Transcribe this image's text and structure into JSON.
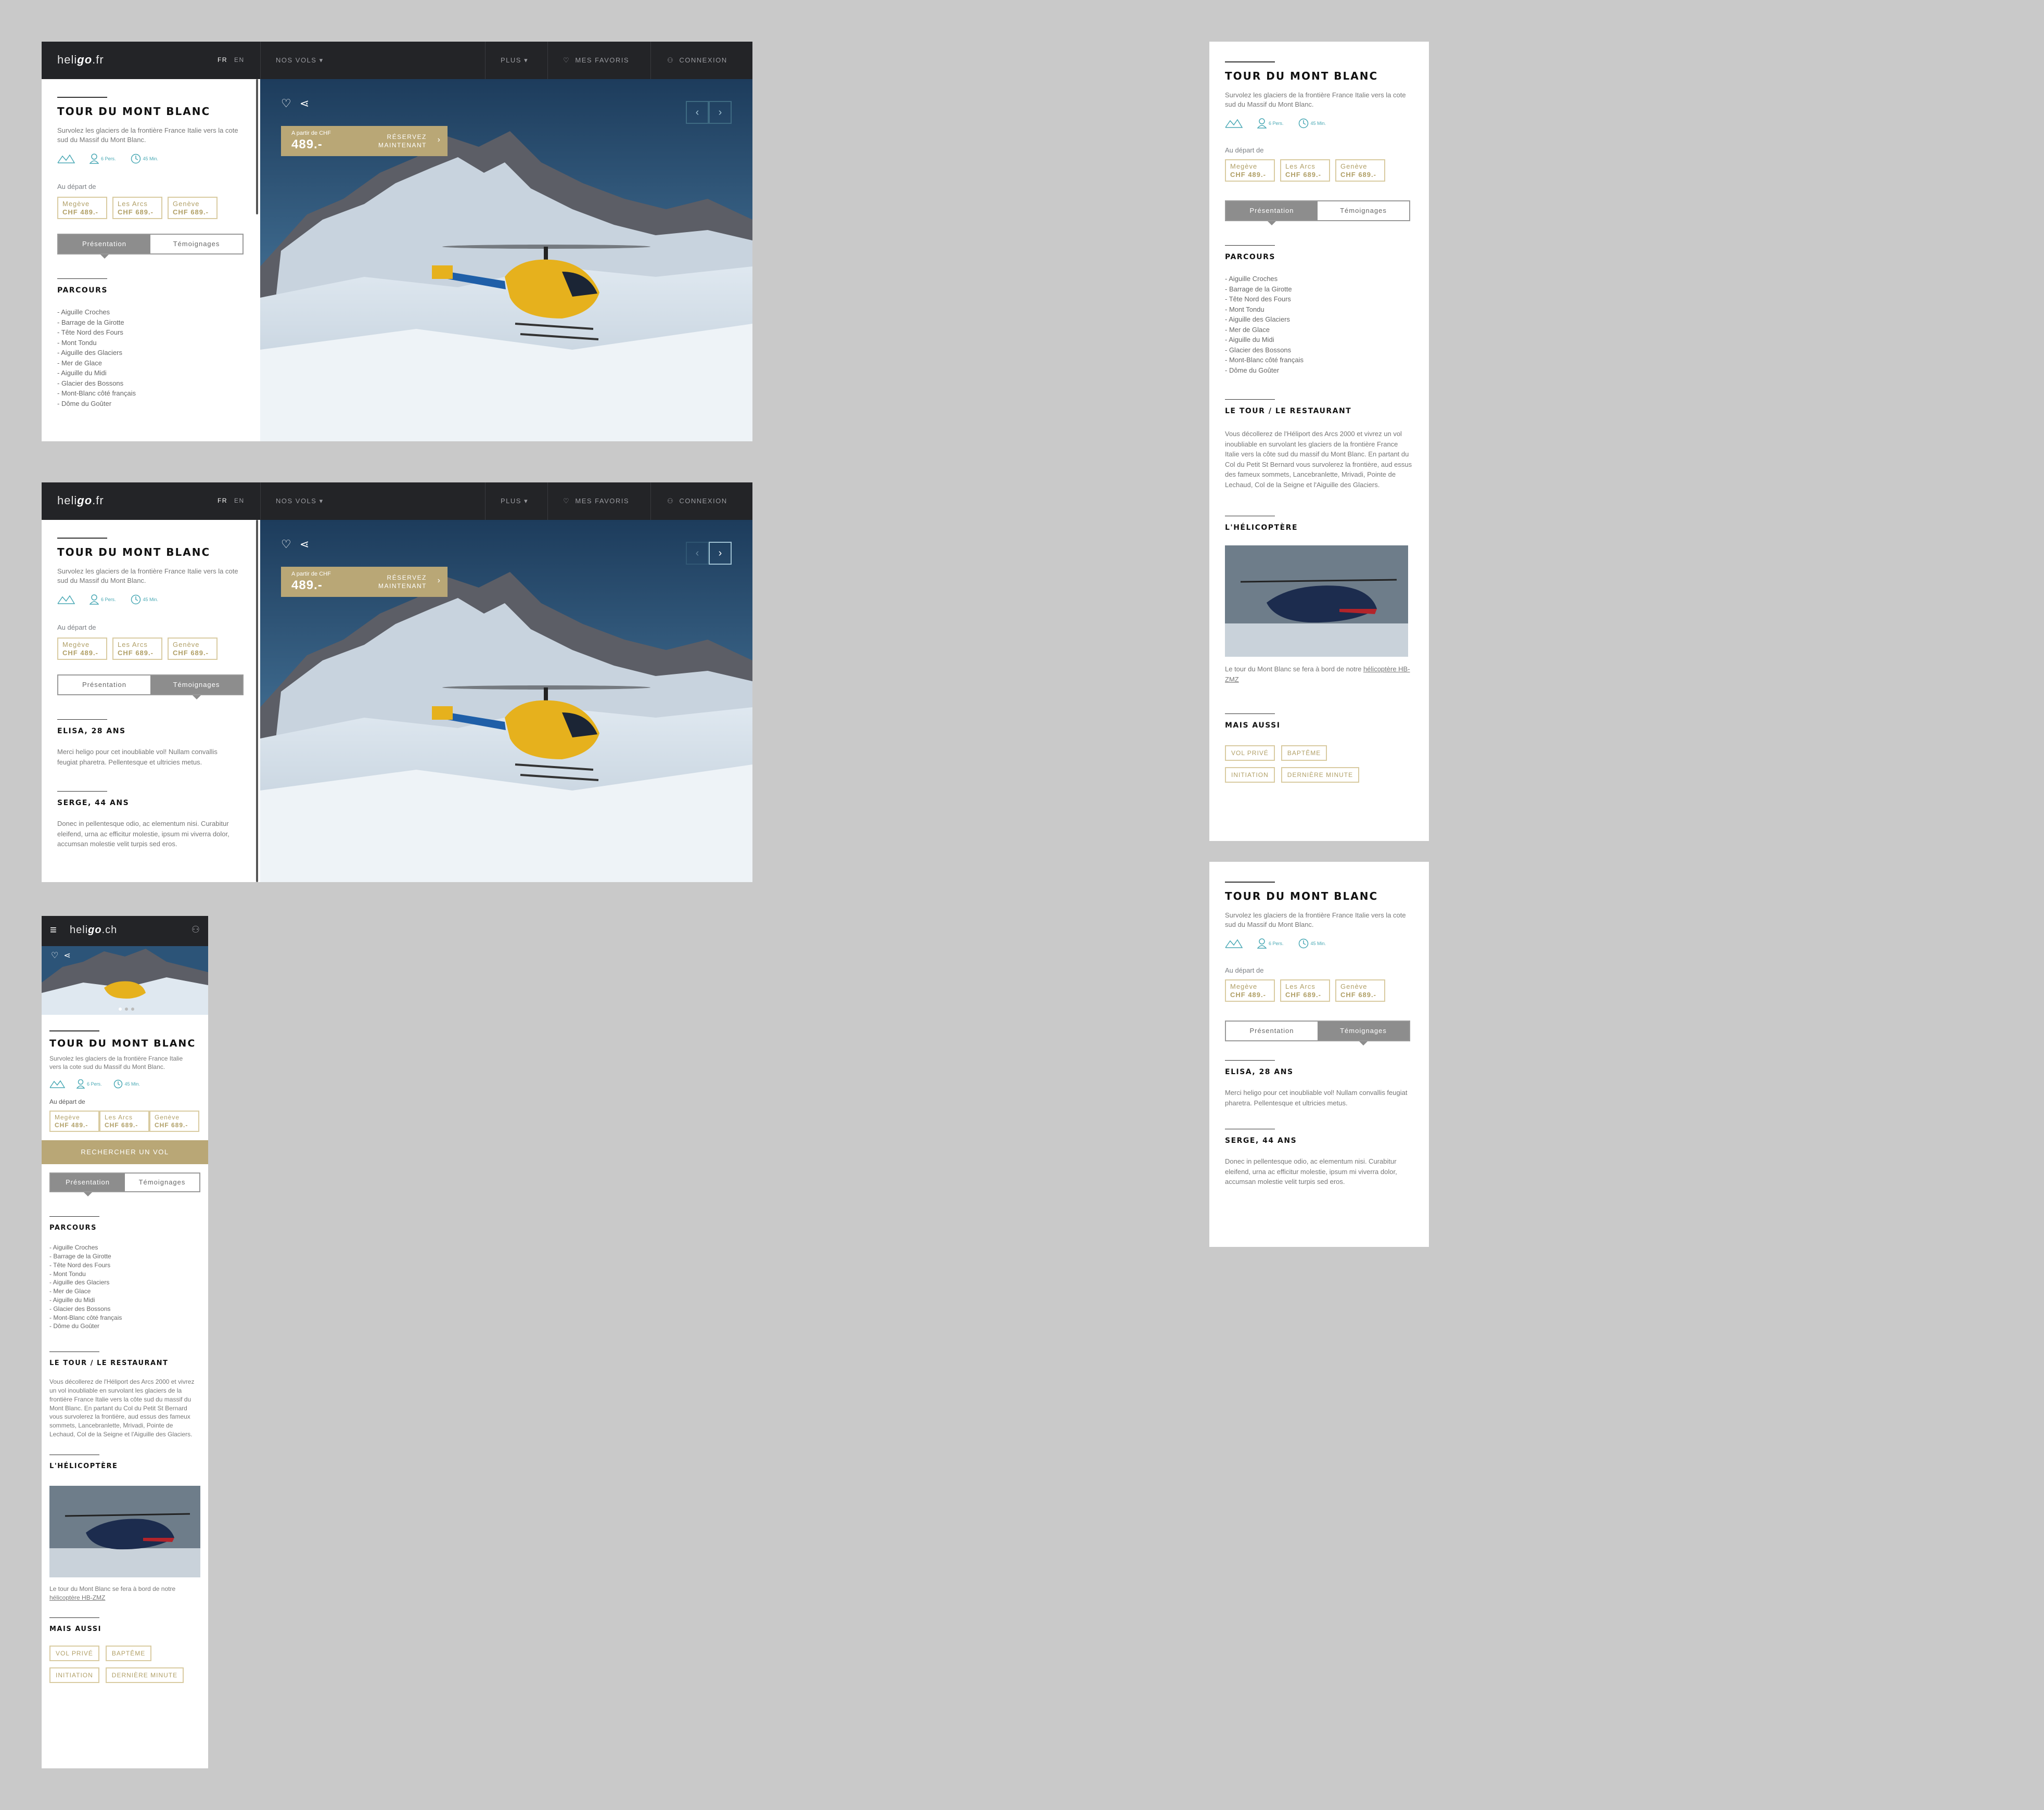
{
  "nav": {
    "logo_pre": "heli",
    "logo_go": "go",
    "logo_fr": ".fr",
    "logo_ch": ".ch",
    "lang_fr": "FR",
    "lang_en": "EN",
    "nos_vols": "NOS VOLS",
    "plus": "PLUS",
    "favoris": "MES FAVORIS",
    "connexion": "CONNEXION"
  },
  "tour": {
    "title": "TOUR DU MONT BLANC",
    "lead": "Survolez les glaciers de la frontière France Italie vers la cote sud du Massif du Mont Blanc.",
    "persons": "6 Pers.",
    "minutes": "45 Min.",
    "depart_label": "Au départ de",
    "departures": [
      {
        "city": "Megève",
        "price": "CHF 489.-"
      },
      {
        "city": "Les Arcs",
        "price": "CHF 689.-"
      },
      {
        "city": "Genève",
        "price": "CHF 689.-"
      }
    ],
    "tab_presentation": "Présentation",
    "tab_temoignages": "Témoignages",
    "parcours_title": "PARCOURS",
    "parcours": [
      "- Aiguille Croches",
      "- Barrage de la Girotte",
      "- Tête Nord des Fours",
      "- Mont Tondu",
      "- Aiguille des Glaciers",
      "- Mer de Glace",
      "- Aiguille du Midi",
      "- Glacier des Bossons",
      "- Mont-Blanc côté français",
      "- Dôme du Goûter"
    ],
    "resto_title": "LE TOUR / LE RESTAURANT",
    "resto_text": "Vous décollerez de l'Héliport des Arcs 2000 et vivrez un vol inoubliable en survolant les glaciers de la frontière France Italie vers la côte sud du massif du Mont Blanc. En partant du Col du Petit St Bernard vous survolerez la frontière, aud essus des fameux sommets, Lancebranlette, Mrivadi, Pointe de Lechaud, Col de la Seigne et l'Aiguille des Glaciers.",
    "heli_title": "L'HÉLICOPTÈRE",
    "heli_text_pre": "Le tour du Mont Blanc se fera à bord de notre ",
    "heli_link": "hélicoptère HB-ZMZ",
    "aussi_title": "MAIS AUSSI",
    "aussi": [
      "VOL PRIVÉ",
      "BAPTÊME",
      "INITIATION",
      "DERNIÈRE MINUTE"
    ],
    "search_btn": "RECHERCHER UN VOL"
  },
  "testimonials": [
    {
      "name": "ELISA, 28 ANS",
      "text": "Merci heligo pour cet inoubliable vol! Nullam convallis feugiat pharetra. Pellentesque et ultricies metus."
    },
    {
      "name": "SERGE, 44 ANS",
      "text": "Donec in pellentesque odio, ac elementum nisi. Curabitur eleifend, urna ac efficitur molestie, ipsum mi viverra dolor, accumsan molestie velit turpis sed eros."
    }
  ],
  "hero": {
    "from_label": "A partir de CHF",
    "price": "489.-",
    "cta_line1": "RÉSERVEZ",
    "cta_line2": "MAINTENANT"
  },
  "colors": {
    "gold": "#b9a776",
    "dark": "#232427",
    "teal": "#4aa9b5"
  }
}
